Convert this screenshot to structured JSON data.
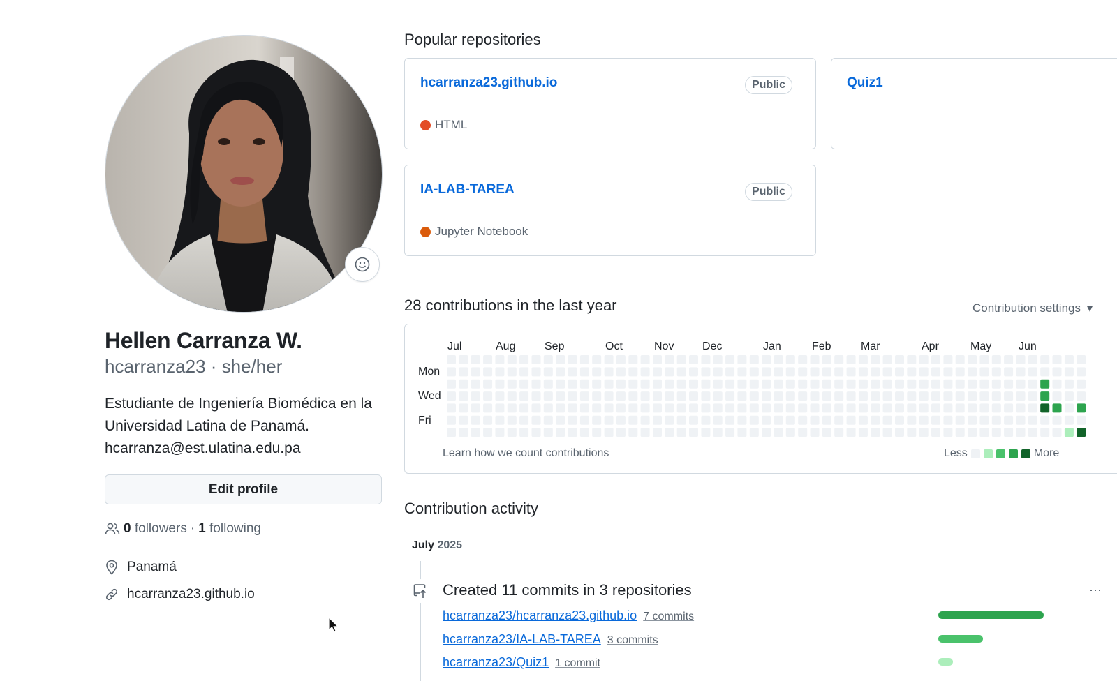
{
  "profile": {
    "name": "Hellen Carranza W.",
    "login_line": "hcarranza23 · she/her",
    "bio_lines": [
      "Estudiante de Ingeniería Biomédica en la",
      "Universidad Latina de Panamá.",
      "hcarranza@est.ulatina.edu.pa"
    ],
    "edit_button": "Edit profile",
    "followers_count": "0",
    "followers_label": "followers",
    "separator": "·",
    "following_count": "1",
    "following_label": "following",
    "location": "Panamá",
    "website": "hcarranza23.github.io"
  },
  "popular": {
    "title": "Popular repositories",
    "repos": [
      {
        "name": "hcarranza23.github.io",
        "visibility": "Public",
        "language": "HTML",
        "language_color": "#e34c26"
      },
      {
        "name": "Quiz1",
        "visibility": "",
        "language": "",
        "language_color": ""
      },
      {
        "name": "IA-LAB-TAREA",
        "visibility": "Public",
        "language": "Jupyter Notebook",
        "language_color": "#DA5B0B"
      }
    ]
  },
  "contributions": {
    "title": "28 contributions in the last year",
    "settings_label": "Contribution settings",
    "months": [
      "Jul",
      "Aug",
      "Sep",
      "Oct",
      "Nov",
      "Dec",
      "Jan",
      "Feb",
      "Mar",
      "Apr",
      "May",
      "Jun"
    ],
    "days": [
      "Mon",
      "Wed",
      "Fri"
    ],
    "learn_link": "Learn how we count contributions",
    "legend_less": "Less",
    "legend_more": "More",
    "level_colors": [
      "#eff2f5",
      "#aceebb",
      "#4ac26b",
      "#2da44e",
      "#116329"
    ],
    "active_cells": [
      {
        "week": 49,
        "day": 2,
        "level": 3
      },
      {
        "week": 49,
        "day": 3,
        "level": 3
      },
      {
        "week": 49,
        "day": 4,
        "level": 4
      },
      {
        "week": 50,
        "day": 4,
        "level": 3
      },
      {
        "week": 52,
        "day": 4,
        "level": 3
      },
      {
        "week": 51,
        "day": 6,
        "level": 1
      },
      {
        "week": 52,
        "day": 6,
        "level": 4
      }
    ]
  },
  "activity": {
    "title": "Contribution activity",
    "month": "July",
    "year": "2025",
    "summary": "Created 11 commits in 3 repositories",
    "rows": [
      {
        "repo": "hcarranza23/hcarranza23.github.io",
        "commits": "7 commits",
        "share": 0.64
      },
      {
        "repo": "hcarranza23/IA-LAB-TAREA",
        "commits": "3 commits",
        "share": 0.27
      },
      {
        "repo": "hcarranza23/Quiz1",
        "commits": "1 commit",
        "share": 0.09
      }
    ]
  }
}
